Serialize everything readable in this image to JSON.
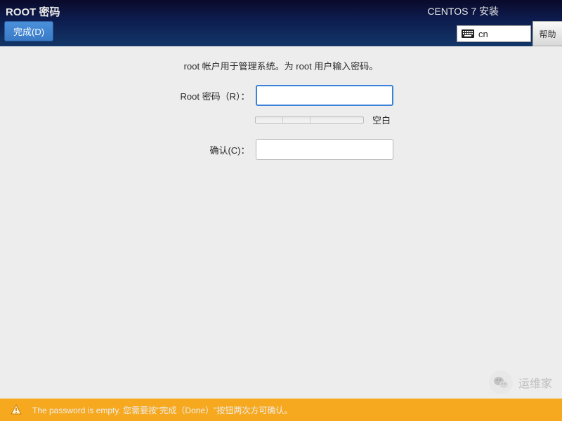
{
  "header": {
    "page_title": "ROOT 密码",
    "done_button": "完成(D)",
    "installer_title": "CENTOS 7 安装",
    "keyboard_layout": "cn",
    "help_button": "帮助"
  },
  "content": {
    "description": "root 帐户用于管理系统。为 root 用户输入密码。",
    "password_label": "Root 密码（R）：",
    "password_value": "",
    "confirm_label": "确认(C)：",
    "confirm_value": "",
    "strength_text": "空白"
  },
  "warning": {
    "message": "The password is empty. 您需要按\"完成（Done）\"按钮两次方可确认。"
  },
  "watermark": {
    "text": "运维家"
  }
}
